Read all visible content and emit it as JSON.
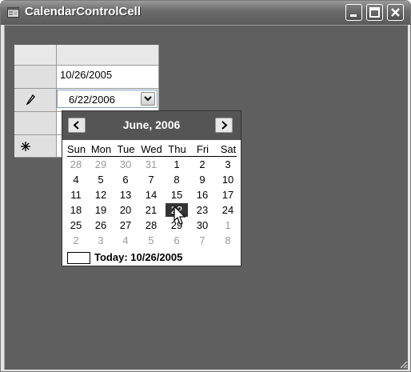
{
  "window": {
    "title": "CalendarControlCell",
    "icon": "app-window-icon",
    "controls": [
      "minimize-icon",
      "maximize-icon",
      "close-icon"
    ]
  },
  "grid": {
    "row_indicators": [
      "",
      "pencil-icon",
      "",
      "asterisk-icon"
    ],
    "cells": [
      "10/26/2005",
      "6/22/2006"
    ]
  },
  "calendar": {
    "month_label": "June, 2006",
    "prev_icon": "chevron-left-icon",
    "next_icon": "chevron-right-icon",
    "weekdays": [
      "Sun",
      "Mon",
      "Tue",
      "Wed",
      "Thu",
      "Fri",
      "Sat"
    ],
    "weeks": [
      [
        "28",
        "29",
        "30",
        "31",
        "1",
        "2",
        "3"
      ],
      [
        "4",
        "5",
        "6",
        "7",
        "8",
        "9",
        "10"
      ],
      [
        "11",
        "12",
        "13",
        "14",
        "15",
        "16",
        "17"
      ],
      [
        "18",
        "19",
        "20",
        "21",
        "22",
        "23",
        "24"
      ],
      [
        "25",
        "26",
        "27",
        "28",
        "29",
        "30",
        "1"
      ],
      [
        "2",
        "3",
        "4",
        "5",
        "6",
        "7",
        "8"
      ]
    ],
    "selected_day": "22",
    "today_label": "Today: 10/26/2005"
  }
}
